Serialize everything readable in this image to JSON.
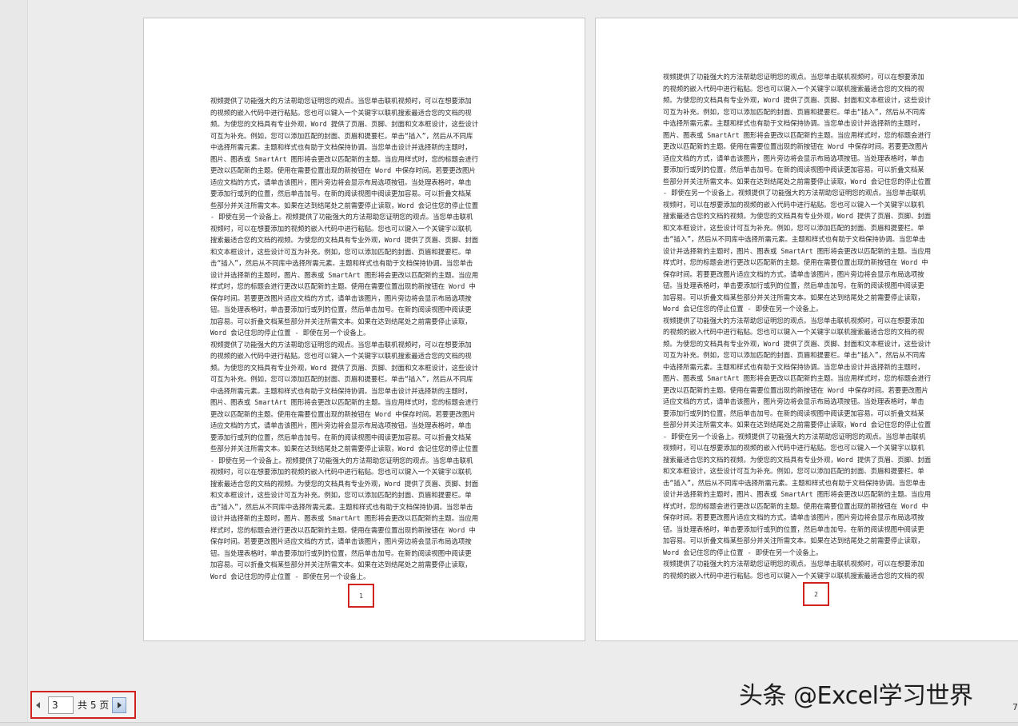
{
  "pages": [
    {
      "number": "1",
      "text": "视频提供了功能强大的方法帮助您证明您的观点。当您单击联机视频时，可以在想要添加\n的视频的嵌入代码中进行粘贴。您也可以键入一个关键字以联机搜索最适合您的文档的视\n频。为使您的文档具有专业外观，Word 提供了页眉、页脚、封面和文本框设计，这些设计\n可互为补充。例如，您可以添加匹配的封面、页眉和提要栏。单击“插入”，然后从不同库\n中选择所需元素。主题和样式也有助于文档保持协调。当您单击设计并选择新的主题时，\n图片、图表或 SmartArt 图形将会更改以匹配新的主题。当应用样式时，您的标题会进行\n更改以匹配新的主题。使用在需要位置出现的新按钮在 Word 中保存时间。若要更改图片\n适应文档的方式，请单击该图片，图片旁边将会显示布局选项按钮。当处理表格时，单击\n要添加行或列的位置，然后单击加号。在新的阅读视图中阅读更加容易。可以折叠文档某\n些部分并关注所需文本。如果在达到结尾处之前需要停止读取，Word 会记住您的停止位置\n- 即使在另一个设备上。视频提供了功能强大的方法帮助您证明您的观点。当您单击联机\n视频时，可以在想要添加的视频的嵌入代码中进行粘贴。您也可以键入一个关键字以联机\n搜索最适合您的文档的视频。为使您的文档具有专业外观，Word 提供了页眉、页脚、封面\n和文本框设计，这些设计可互为补充。例如，您可以添加匹配的封面、页眉和提要栏。单\n击“插入”，然后从不同库中选择所需元素。主题和样式也有助于文档保持协调。当您单击\n设计并选择新的主题时，图片、图表或 SmartArt 图形将会更改以匹配新的主题。当应用\n样式时，您的标题会进行更改以匹配新的主题。使用在需要位置出现的新按钮在 Word 中\n保存时间。若要更改图片适应文档的方式，请单击该图片，图片旁边将会显示布局选项按\n钮。当处理表格时，单击要添加行或列的位置，然后单击加号。在新的阅读视图中阅读更\n加容易。可以折叠文档某些部分并关注所需文本。如果在达到结尾处之前需要停止读取，\nWord 会记住您的停止位置 - 即使在另一个设备上。\n视频提供了功能强大的方法帮助您证明您的观点。当您单击联机视频时，可以在想要添加\n的视频的嵌入代码中进行粘贴。您也可以键入一个关键字以联机搜索最适合您的文档的视\n频。为使您的文档具有专业外观，Word 提供了页眉、页脚、封面和文本框设计，这些设计\n可互为补充。例如，您可以添加匹配的封面、页眉和提要栏。单击“插入”，然后从不同库\n中选择所需元素。主题和样式也有助于文档保持协调。当您单击设计并选择新的主题时，\n图片、图表或 SmartArt 图形将会更改以匹配新的主题。当应用样式时，您的标题会进行\n更改以匹配新的主题。使用在需要位置出现的新按钮在 Word 中保存时间。若要更改图片\n适应文档的方式，请单击该图片，图片旁边将会显示布局选项按钮。当处理表格时，单击\n要添加行或列的位置，然后单击加号。在新的阅读视图中阅读更加容易。可以折叠文档某\n些部分并关注所需文本。如果在达到结尾处之前需要停止读取，Word 会记住您的停止位置\n- 即使在另一个设备上。视频提供了功能强大的方法帮助您证明您的观点。当您单击联机\n视频时，可以在想要添加的视频的嵌入代码中进行粘贴。您也可以键入一个关键字以联机\n搜索最适合您的文档的视频。为使您的文档具有专业外观，Word 提供了页眉、页脚、封面\n和文本框设计，这些设计可互为补充。例如，您可以添加匹配的封面、页眉和提要栏。单\n击“插入”，然后从不同库中选择所需元素。主题和样式也有助于文档保持协调。当您单击\n设计并选择新的主题时，图片、图表或 SmartArt 图形将会更改以匹配新的主题。当应用\n样式时，您的标题会进行更改以匹配新的主题。使用在需要位置出现的新按钮在 Word 中\n保存时间。若要更改图片适应文档的方式，请单击该图片，图片旁边将会显示布局选项按\n钮。当处理表格时，单击要添加行或列的位置，然后单击加号。在新的阅读视图中阅读更\n加容易。可以折叠文档某些部分并关注所需文本。如果在达到结尾处之前需要停止读取，\nWord 会记住您的停止位置 - 即使在另一个设备上。"
    },
    {
      "number": "2",
      "text": "视频提供了功能强大的方法帮助您证明您的观点。当您单击联机视频时，可以在想要添加\n的视频的嵌入代码中进行粘贴。您也可以键入一个关键字以联机搜索最适合您的文档的视\n频。为使您的文档具有专业外观，Word 提供了页眉、页脚、封面和文本框设计，这些设计\n可互为补充。例如，您可以添加匹配的封面、页眉和提要栏。单击“插入”，然后从不同库\n中选择所需元素。主题和样式也有助于文档保持协调。当您单击设计并选择新的主题时，\n图片、图表或 SmartArt 图形将会更改以匹配新的主题。当应用样式时，您的标题会进行\n更改以匹配新的主题。使用在需要位置出现的新按钮在 Word 中保存时间。若要更改图片\n适应文档的方式，请单击该图片，图片旁边将会显示布局选项按钮。当处理表格时，单击\n要添加行或列的位置，然后单击加号。在新的阅读视图中阅读更加容易。可以折叠文档某\n些部分并关注所需文本。如果在达到结尾处之前需要停止读取，Word 会记住您的停止位置\n- 即使在另一个设备上。视频提供了功能强大的方法帮助您证明您的观点。当您单击联机\n视频时，可以在想要添加的视频的嵌入代码中进行粘贴。您也可以键入一个关键字以联机\n搜索最适合您的文档的视频。为使您的文档具有专业外观，Word 提供了页眉、页脚、封面\n和文本框设计，这些设计可互为补充。例如，您可以添加匹配的封面、页眉和提要栏。单\n击“插入”，然后从不同库中选择所需元素。主题和样式也有助于文档保持协调。当您单击\n设计并选择新的主题时，图片、图表或 SmartArt 图形将会更改以匹配新的主题。当应用\n样式时，您的标题会进行更改以匹配新的主题。使用在需要位置出现的新按钮在 Word 中\n保存时间。若要更改图片适应文档的方式，请单击该图片，图片旁边将会显示布局选项按\n钮。当处理表格时，单击要添加行或列的位置，然后单击加号。在新的阅读视图中阅读更\n加容易。可以折叠文档某些部分并关注所需文本。如果在达到结尾处之前需要停止读取，\nWord 会记住您的停止位置 - 即使在另一个设备上。\n视频提供了功能强大的方法帮助您证明您的观点。当您单击联机视频时，可以在想要添加\n的视频的嵌入代码中进行粘贴。您也可以键入一个关键字以联机搜索最适合您的文档的视\n频。为使您的文档具有专业外观，Word 提供了页眉、页脚、封面和文本框设计，这些设计\n可互为补充。例如，您可以添加匹配的封面、页眉和提要栏。单击“插入”，然后从不同库\n中选择所需元素。主题和样式也有助于文档保持协调。当您单击设计并选择新的主题时，\n图片、图表或 SmartArt 图形将会更改以匹配新的主题。当应用样式时，您的标题会进行\n更改以匹配新的主题。使用在需要位置出现的新按钮在 Word 中保存时间。若要更改图片\n适应文档的方式，请单击该图片，图片旁边将会显示布局选项按钮。当处理表格时，单击\n要添加行或列的位置，然后单击加号。在新的阅读视图中阅读更加容易。可以折叠文档某\n些部分并关注所需文本。如果在达到结尾处之前需要停止读取，Word 会记住您的停止位置\n- 即使在另一个设备上。视频提供了功能强大的方法帮助您证明您的观点。当您单击联机\n视频时，可以在想要添加的视频的嵌入代码中进行粘贴。您也可以键入一个关键字以联机\n搜索最适合您的文档的视频。为使您的文档具有专业外观，Word 提供了页眉、页脚、封面\n和文本框设计，这些设计可互为补充。例如，您可以添加匹配的封面、页眉和提要栏。单\n击“插入”，然后从不同库中选择所需元素。主题和样式也有助于文档保持协调。当您单击\n设计并选择新的主题时，图片、图表或 SmartArt 图形将会更改以匹配新的主题。当应用\n样式时，您的标题会进行更改以匹配新的主题。使用在需要位置出现的新按钮在 Word 中\n保存时间。若要更改图片适应文档的方式，请单击该图片，图片旁边将会显示布局选项按\n钮。当处理表格时，单击要添加行或列的位置，然后单击加号。在新的阅读视图中阅读更\n加容易。可以折叠文档某些部分并关注所需文本。如果在达到结尾处之前需要停止读取，\nWord 会记住您的停止位置 - 即使在另一个设备上。\n视频提供了功能强大的方法帮助您证明您的观点。当您单击联机视频时，可以在想要添加\n的视频的嵌入代码中进行粘贴。您也可以键入一个关键字以联机搜索最适合您的文档的视"
    }
  ],
  "navigator": {
    "current_page": "3",
    "total_label": "共 5 页",
    "prev_icon": "triangle-left-icon",
    "next_icon": "triangle-right-icon"
  },
  "watermark": "头条 @Excel学习世界",
  "edge_number": "7",
  "colors": {
    "highlight_box": "#d2221d",
    "workspace_bg": "#ececec",
    "page_bg": "#ffffff"
  }
}
